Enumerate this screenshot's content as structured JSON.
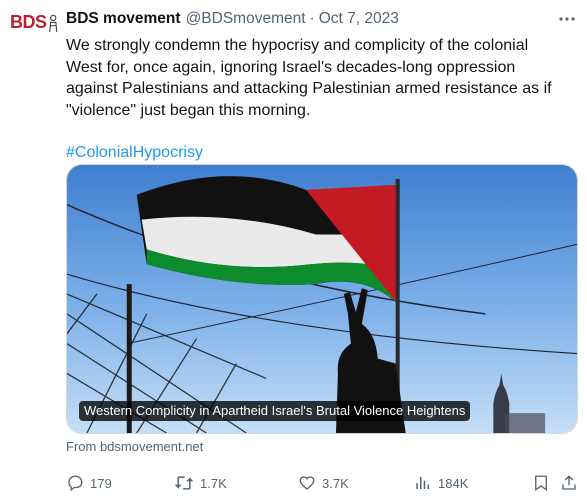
{
  "avatar": {
    "text": "BDS"
  },
  "tweet": {
    "display_name": "BDS movement",
    "handle": "@BDSmovement",
    "separator": "·",
    "date": "Oct 7, 2023",
    "text": "We strongly condemn the hypocrisy and complicity of the colonial West for, once again, ignoring Israel's decades-long oppression against Palestinians and attacking Palestinian armed resistance as if \"violence\" just began this morning.",
    "hashtag": "#ColonialHypocrisy"
  },
  "card": {
    "title": "Western Complicity in Apartheid Israel's Brutal Violence Heightens",
    "source": "From bdsmovement.net"
  },
  "actions": {
    "replies": "179",
    "reposts": "1.7K",
    "likes": "3.7K",
    "views": "184K"
  },
  "colors": {
    "text": "#0f1419",
    "secondary": "#536471",
    "link": "#1d9bf0",
    "brand": "#b5222d"
  }
}
